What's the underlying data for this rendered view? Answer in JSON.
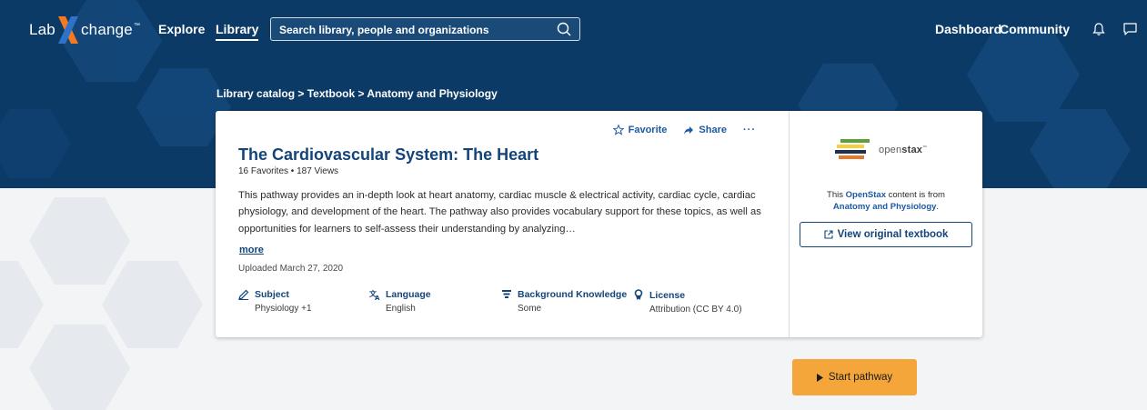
{
  "nav": {
    "logo_left": "Lab",
    "logo_right": "change",
    "logo_tm": "™",
    "explore": "Explore",
    "library": "Library",
    "search_placeholder": "Search library, people and organizations",
    "dashboard": "Dashboard",
    "community": "Community",
    "icons": [
      "search-icon",
      "bell-icon",
      "chat-icon"
    ]
  },
  "breadcrumb": "Library catalog > Textbook > Anatomy and Physiology",
  "card": {
    "actions": {
      "favorite": "Favorite",
      "share": "Share",
      "more": "···"
    },
    "title": "The Cardiovascular System: The Heart",
    "stats": "16 Favorites • 187 Views",
    "description": "This pathway provides an in-depth look at heart anatomy, cardiac muscle & electrical activity, cardiac cycle, cardiac physiology, and development of the heart. The pathway also provides vocabulary support for these topics, as well as opportunities for learners to self-assess their understanding by analyzing…",
    "more": "more",
    "uploaded": "Uploaded March 27, 2020",
    "meta": [
      {
        "label": "Subject",
        "value": "Physiology +1",
        "icon": "pencil-icon"
      },
      {
        "label": "Language",
        "value": "English",
        "icon": "translate-icon"
      },
      {
        "label": "Background Knowledge",
        "value": "Some",
        "icon": "layers-icon"
      },
      {
        "label": "License",
        "value": "Attribution (CC BY 4.0)",
        "icon": "award-icon"
      }
    ]
  },
  "side": {
    "logo_word_light": "open",
    "logo_word_bold": "stax",
    "logo_tm": "™",
    "text_prefix": "This ",
    "text_link": "OpenStax",
    "text_middle": " content is from",
    "text_book": "Anatomy and Physiology",
    "text_end": ".",
    "view_button": "View original textbook"
  },
  "start_button": "Start pathway",
  "colors": {
    "hero": "#0c3a66",
    "brand_orange": "#f47920",
    "link_blue": "#13447a",
    "start_button": "#f5a63a"
  }
}
